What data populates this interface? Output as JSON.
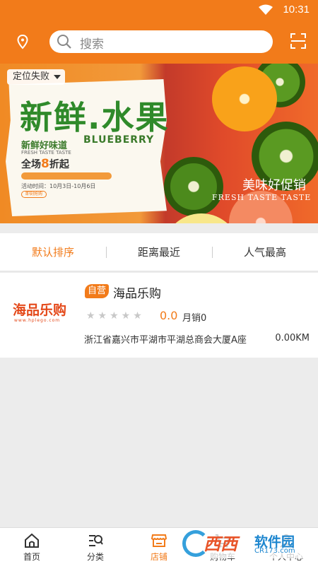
{
  "status_bar": {
    "time": "10:31",
    "wifi_icon": "wifi-icon"
  },
  "header": {
    "location_icon": "location-pin-icon",
    "search_icon": "search-icon",
    "search_placeholder": "搜索",
    "scan_icon": "scan-icon"
  },
  "banner": {
    "location_status": "定位失败",
    "title": "新鲜.水果",
    "subtitle": "新鲜好味道",
    "subtitle_en": "FRESH TASTE TASTE",
    "blueberry": "BLUEBERRY",
    "sale_prefix": "全场",
    "sale_number": "8",
    "sale_suffix": "折起",
    "date_text": "活动时间：10月3日-10月6日",
    "button_text": "即刻抢购",
    "promo": "美味好促销",
    "promo_en": "FRESH TASTE TASTE"
  },
  "sort_tabs": [
    {
      "label": "默认排序",
      "active": true
    },
    {
      "label": "距离最近",
      "active": false
    },
    {
      "label": "人气最高",
      "active": false
    }
  ],
  "shops": [
    {
      "logo_text": "海品乐购",
      "logo_url_text": "www.hplego.com",
      "tag": "自营",
      "name": "海品乐购",
      "stars": 0,
      "stars_glyphs": "★★★★★",
      "rating": "0.0",
      "sales": "月销0",
      "address": "浙江省嘉兴市平湖市平湖总商会大厦A座",
      "distance": "0.00KM"
    }
  ],
  "tab_bar": [
    {
      "label": "首页",
      "icon": "home-icon",
      "active": false
    },
    {
      "label": "分类",
      "icon": "category-icon",
      "active": false
    },
    {
      "label": "店铺",
      "icon": "store-icon",
      "active": true
    },
    {
      "label": "购物车",
      "icon": "cart-icon",
      "active": false
    },
    {
      "label": "个人中心",
      "icon": "person-icon",
      "active": false
    }
  ],
  "watermark": {
    "brand": "西西",
    "brand2": "软件园",
    "site": "CR173.com"
  },
  "colors": {
    "accent": "#f27b1a",
    "green": "#2f8a2a"
  }
}
